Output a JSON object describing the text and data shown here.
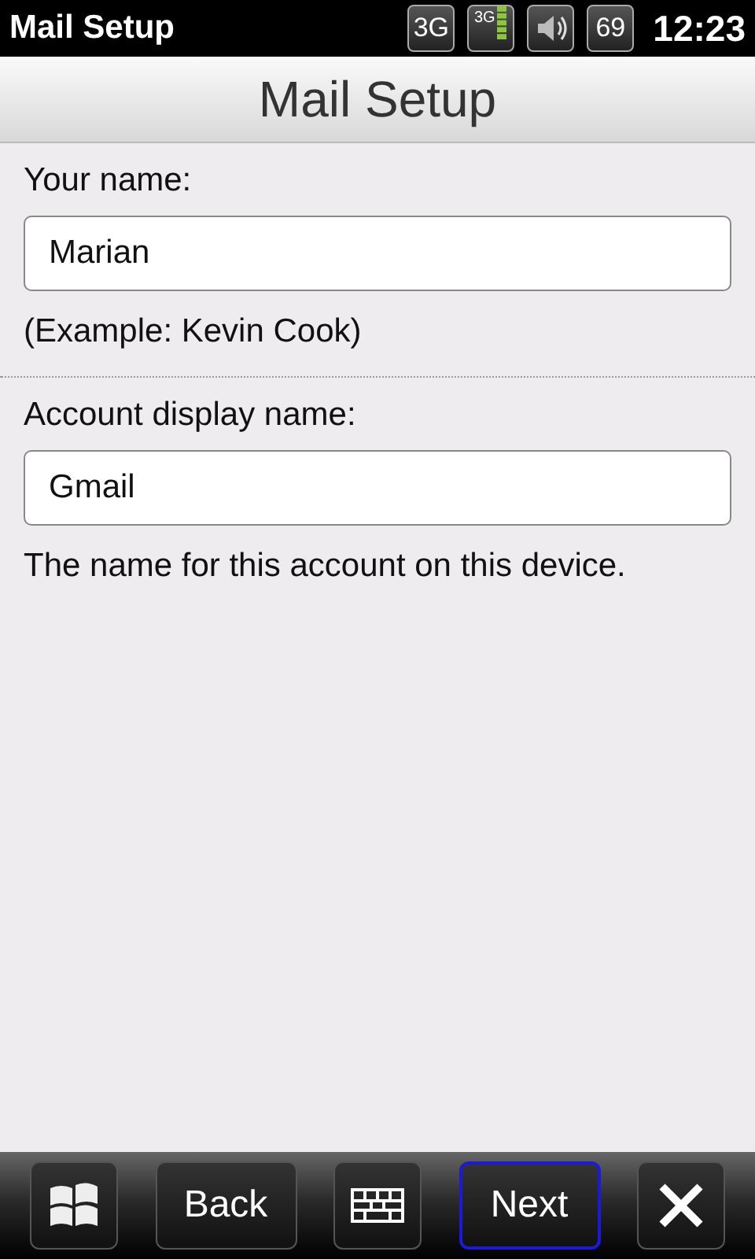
{
  "status_bar": {
    "app_title": "Mail Setup",
    "network": "3G",
    "signal_label": "3G",
    "battery": "69",
    "time": "12:23"
  },
  "title": "Mail Setup",
  "fields": [
    {
      "label": "Your name:",
      "value": "Marian",
      "hint": "(Example: Kevin Cook)"
    },
    {
      "label": "Account display name:",
      "value": "Gmail",
      "hint": "The name for this account on this device."
    }
  ],
  "softkeys": [
    {
      "kind": "start",
      "selected": false
    },
    {
      "kind": "text",
      "label": "Back",
      "selected": false
    },
    {
      "kind": "keyboard",
      "selected": false
    },
    {
      "kind": "text",
      "label": "Next",
      "selected": true
    },
    {
      "kind": "close",
      "selected": false
    }
  ]
}
